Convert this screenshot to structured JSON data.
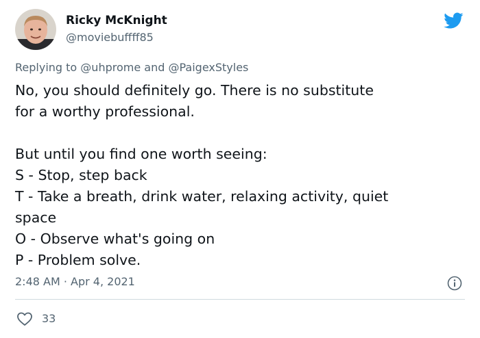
{
  "tweet": {
    "author_name": "Ricky McKnight",
    "author_handle": "@moviebuffff85",
    "reply_prefix": "Replying to",
    "reply_mention_1": "@uhprome",
    "reply_and": "and",
    "reply_mention_2": "@PaigexStyles",
    "body_lines": [
      "No, you should definitely go. There is no substitute",
      "for a worthy professional.",
      "",
      "But until you find one worth seeing:",
      "S - Stop, step back",
      "T - Take a breath, drink water, relaxing activity, quiet",
      "space",
      "O - Observe what's going on",
      "P - Problem solve."
    ],
    "timestamp": "2:48 AM · Apr 4, 2021",
    "like_count": "33"
  },
  "icons": {
    "brand": "twitter-bird-icon",
    "info": "info-icon",
    "like": "heart-icon"
  },
  "colors": {
    "brand_blue": "#1d9bf0",
    "text_primary": "#0f1419",
    "text_secondary": "#536471",
    "divider": "#cfd9de"
  }
}
